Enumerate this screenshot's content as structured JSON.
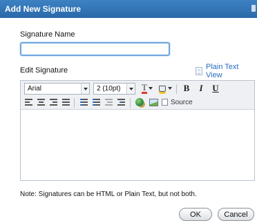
{
  "dialog": {
    "title": "Add New Signature"
  },
  "form": {
    "signature_name_label": "Signature Name",
    "signature_name_value": "",
    "edit_signature_label": "Edit Signature",
    "plain_text_view_link": "Plain Text View"
  },
  "toolbar": {
    "font_family": "Arial",
    "font_size": "2 (10pt)",
    "bold_label": "B",
    "italic_label": "I",
    "underline_label": "U",
    "source_label": "Source"
  },
  "note": "Note: Signatures can be HTML or Plain Text, but not both.",
  "buttons": {
    "ok": "OK",
    "cancel": "Cancel"
  },
  "colors": {
    "title_bar": "#2f73b5",
    "link": "#2a6cc4",
    "focus_border": "#6ea6dc"
  }
}
